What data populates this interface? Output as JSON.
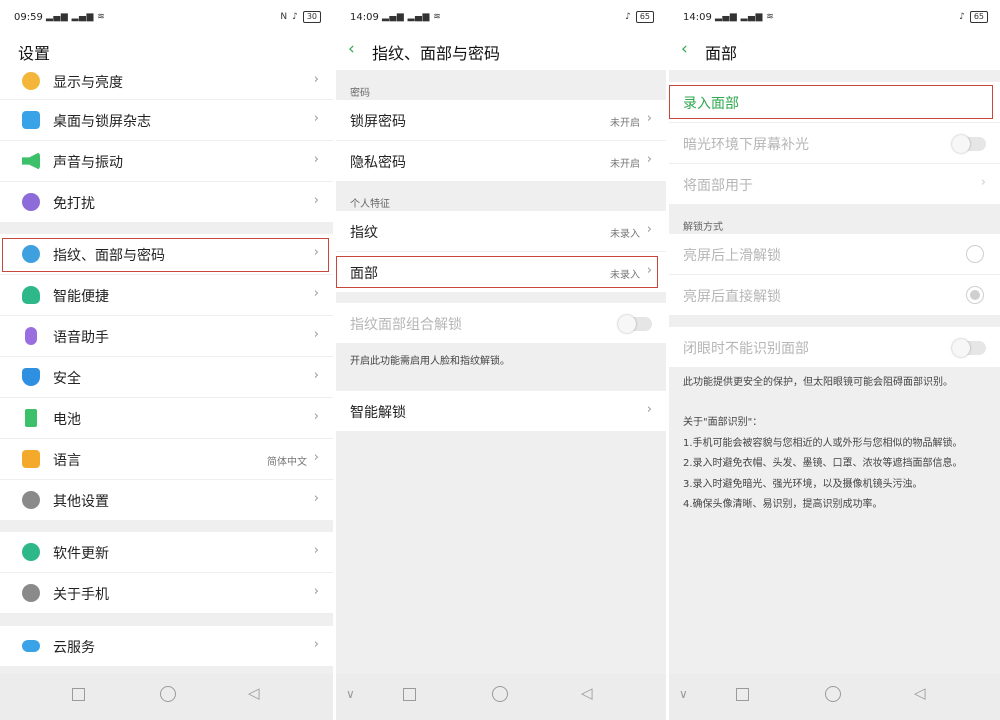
{
  "colors": {
    "accent_green": "#2fa84f",
    "highlight_red": "#c9463d"
  },
  "screen1": {
    "status": {
      "time": "09:59",
      "network": "ᵴᶥ ᵴᶥ",
      "right": "N",
      "battery": "30"
    },
    "title": "设置",
    "items": [
      {
        "label": "显示与亮度",
        "icon": "brightness-icon"
      },
      {
        "label": "桌面与锁屏杂志",
        "icon": "wallpaper-icon"
      },
      {
        "label": "声音与振动",
        "icon": "speaker-icon"
      },
      {
        "label": "免打扰",
        "icon": "moon-icon"
      },
      {
        "label": "指纹、面部与密码",
        "icon": "fingerprint-face-icon"
      },
      {
        "label": "智能便捷",
        "icon": "smart-head-icon"
      },
      {
        "label": "语音助手",
        "icon": "microphone-icon"
      },
      {
        "label": "安全",
        "icon": "shield-icon"
      },
      {
        "label": "电池",
        "icon": "battery-icon"
      },
      {
        "label": "语言",
        "icon": "language-icon",
        "value": "简体中文"
      },
      {
        "label": "其他设置",
        "icon": "gear-icon"
      },
      {
        "label": "软件更新",
        "icon": "update-icon"
      },
      {
        "label": "关于手机",
        "icon": "info-icon"
      },
      {
        "label": "云服务",
        "icon": "cloud-icon"
      }
    ]
  },
  "screen2": {
    "status": {
      "time": "14:09",
      "battery": "65"
    },
    "title": "指纹、面部与密码",
    "section_password": "密码",
    "lock_password": {
      "label": "锁屏密码",
      "value": "未开启"
    },
    "privacy_password": {
      "label": "隐私密码",
      "value": "未开启"
    },
    "section_personal": "个人特征",
    "fingerprint": {
      "label": "指纹",
      "value": "未录入"
    },
    "face": {
      "label": "面部",
      "value": "未录入"
    },
    "combo_unlock": {
      "label": "指纹面部组合解锁"
    },
    "combo_note": "开启此功能需启用人脸和指纹解锁。",
    "smart_unlock": {
      "label": "智能解锁"
    }
  },
  "screen3": {
    "status": {
      "time": "14:09",
      "battery": "65"
    },
    "title": "面部",
    "enroll": "录入面部",
    "dark_fill": "暗光环境下屏幕补光",
    "use_face_for": "将面部用于",
    "section_unlock": "解锁方式",
    "swipe_unlock": "亮屏后上滑解锁",
    "direct_unlock": "亮屏后直接解锁",
    "eyes_closed": "闭眼时不能识别面部",
    "note_intro": "此功能提供更安全的保护，但太阳眼镜可能会阻碍面部识别。",
    "about_title": "关于\"面部识别\"：",
    "about_lines": [
      "1.手机可能会被容貌与您相近的人或外形与您相似的物品解锁。",
      "2.录入时避免衣帽、头发、墨镜、口罩、浓妆等遮挡面部信息。",
      "3.录入时避免暗光、强光环境，以及摄像机镜头污浊。",
      "4.确保头像清晰、易识别，提高识别成功率。"
    ]
  },
  "chevron": "›",
  "back": "‹"
}
